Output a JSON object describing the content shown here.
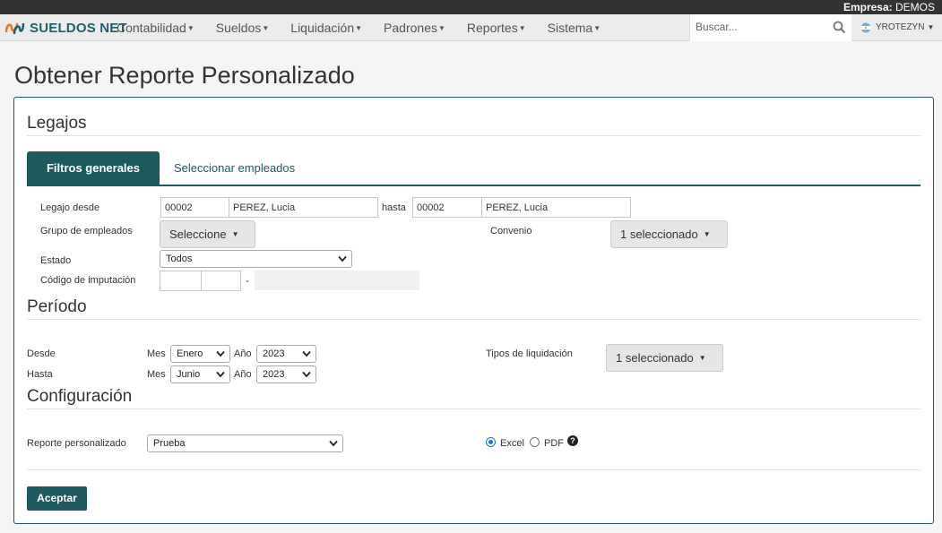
{
  "topbar": {
    "empresa_label": "Empresa:",
    "empresa_value": "DEMOS"
  },
  "brand": {
    "name": "SUELDOS NET"
  },
  "nav": {
    "items": [
      {
        "label": "Contabilidad"
      },
      {
        "label": "Sueldos"
      },
      {
        "label": "Liquidación"
      },
      {
        "label": "Padrones"
      },
      {
        "label": "Reportes"
      },
      {
        "label": "Sistema"
      }
    ]
  },
  "search": {
    "placeholder": "Buscar..."
  },
  "user": {
    "name": "YROTEZYN"
  },
  "page": {
    "title": "Obtener Reporte Personalizado"
  },
  "legajos": {
    "title": "Legajos",
    "tabs": [
      {
        "label": "Filtros generales"
      },
      {
        "label": "Seleccionar empleados"
      }
    ],
    "legajo_desde_label": "Legajo desde",
    "legajo_desde_code": "00002",
    "legajo_desde_name": "PEREZ, Lucia",
    "hasta_label": "hasta",
    "legajo_hasta_code": "00002",
    "legajo_hasta_name": "PEREZ, Lucia",
    "grupo_label": "Grupo de empleados",
    "grupo_value": "Seleccione",
    "convenio_label": "Convenio",
    "convenio_value": "1 seleccionado",
    "estado_label": "Estado",
    "estado_value": "Todos",
    "codigo_label": "Código de imputación",
    "codigo_sep": "-"
  },
  "periodo": {
    "title": "Período",
    "desde_label": "Desde",
    "hasta_label": "Hasta",
    "mes_label": "Mes",
    "anio_label": "Año",
    "desde_mes": "Enero",
    "desde_anio": "2023",
    "hasta_mes": "Junio",
    "hasta_anio": "2023",
    "tipos_label": "Tipos de liquidación",
    "tipos_value": "1 seleccionado"
  },
  "configuracion": {
    "title": "Configuración",
    "reporte_label": "Reporte personalizado",
    "reporte_value": "Prueba",
    "format_excel": "Excel",
    "format_pdf": "PDF",
    "selected_format": "Excel"
  },
  "actions": {
    "accept_label": "Aceptar"
  },
  "colors": {
    "accent": "#1e5960",
    "topbar": "#333333"
  }
}
